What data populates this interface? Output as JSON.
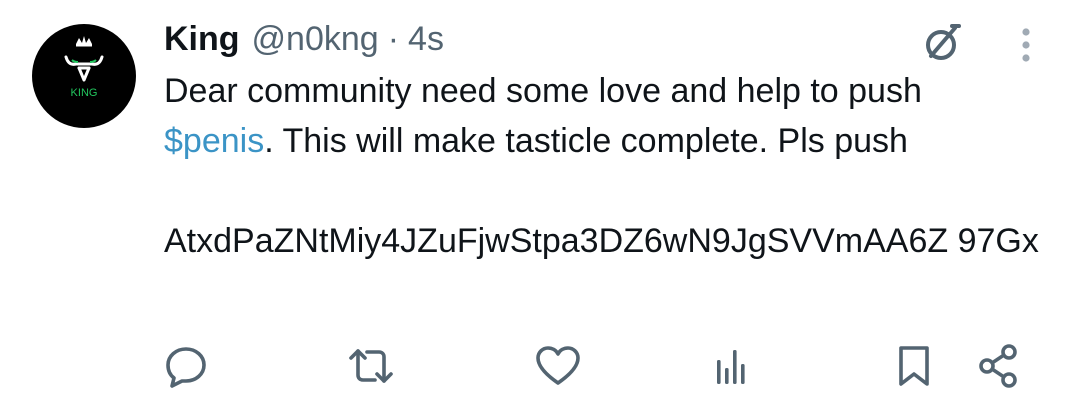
{
  "tweet": {
    "author": {
      "name": "King",
      "handle": "@n0kng",
      "avatar_text": "KING"
    },
    "separator": "·",
    "time": "4s",
    "text": {
      "line1": "Dear community need some love and help to push",
      "cashtag": "$penis",
      "line2_rest": ". This will make tasticle complete. Pls push",
      "address": "AtxdPaZNtMiy4JZuFjwStpa3DZ6wN9JgSVVmAA6Z 97Gx"
    }
  },
  "actions": [
    "reply",
    "repost",
    "like",
    "views",
    "bookmark",
    "share"
  ],
  "colors": {
    "text": "#0f1419",
    "muted": "#536471",
    "link": "#3b94c6",
    "avatar_accent": "#22c55e"
  }
}
